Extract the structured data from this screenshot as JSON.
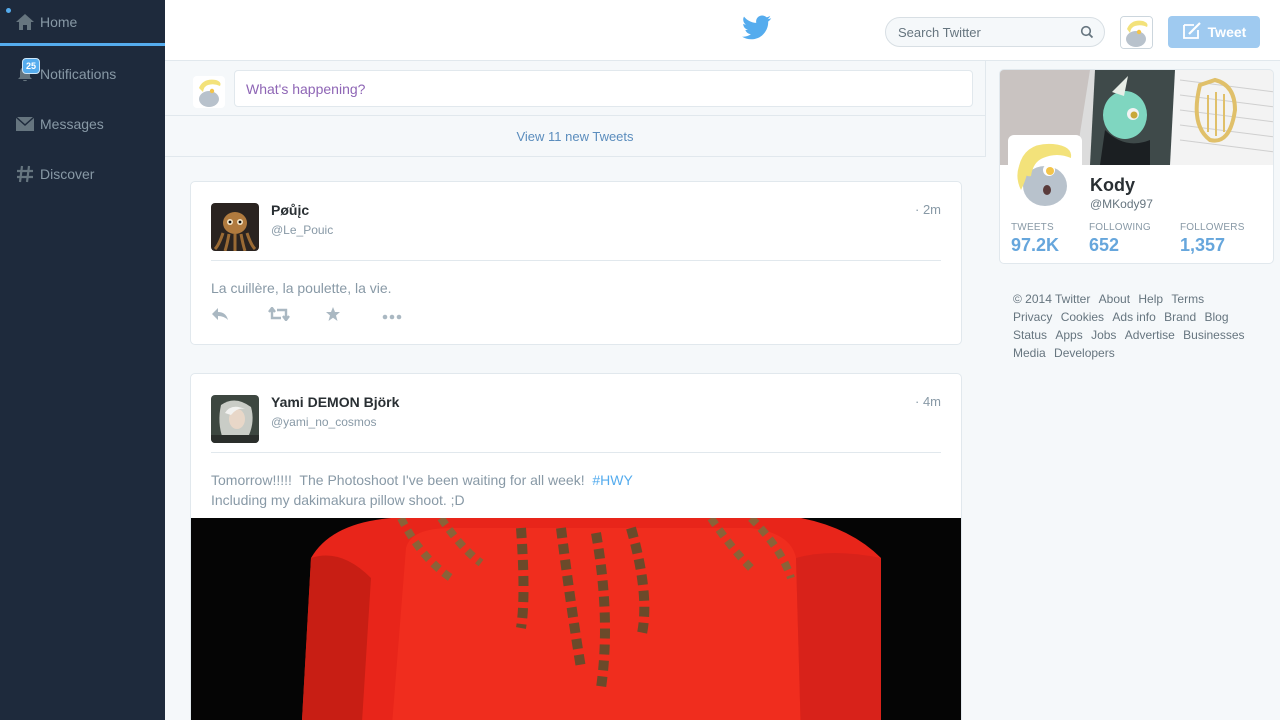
{
  "sidebar": {
    "items": [
      {
        "label": "Home",
        "icon": "home-icon"
      },
      {
        "label": "Notifications",
        "icon": "bell-icon",
        "badge": "25"
      },
      {
        "label": "Messages",
        "icon": "envelope-icon"
      },
      {
        "label": "Discover",
        "icon": "hash-icon"
      }
    ]
  },
  "header": {
    "search_placeholder": "Search Twitter",
    "tweet_button": "Tweet",
    "brand_color": "#55acee"
  },
  "compose": {
    "placeholder": "What's happening?",
    "new_tweets": "View 11 new Tweets"
  },
  "tweets": [
    {
      "name": "Pøůįc",
      "handle": "@Le_Pouic",
      "time": "· 2m",
      "text": "La cuillère, la poulette, la vie."
    },
    {
      "name": "Yami DEMON Björk",
      "handle": "@yami_no_cosmos",
      "time": "· 4m",
      "text_line1": "Tomorrow!!!!!  The Photoshoot I've been waiting for all week!  ",
      "hashtag": "#HWY",
      "text_line2": "Including my dakimakura pillow shoot. ;D"
    }
  ],
  "profile": {
    "name": "Kody",
    "handle": "@MKody97",
    "stats": [
      {
        "label": "TWEETS",
        "value": "97.2K"
      },
      {
        "label": "FOLLOWING",
        "value": "652"
      },
      {
        "label": "FOLLOWERS",
        "value": "1,357"
      }
    ]
  },
  "footer": {
    "links": [
      "© 2014 Twitter",
      "About",
      "Help",
      "Terms",
      "Privacy",
      "Cookies",
      "Ads info",
      "Brand",
      "Blog",
      "Status",
      "Apps",
      "Jobs",
      "Advertise",
      "Businesses",
      "Media",
      "Developers"
    ]
  }
}
